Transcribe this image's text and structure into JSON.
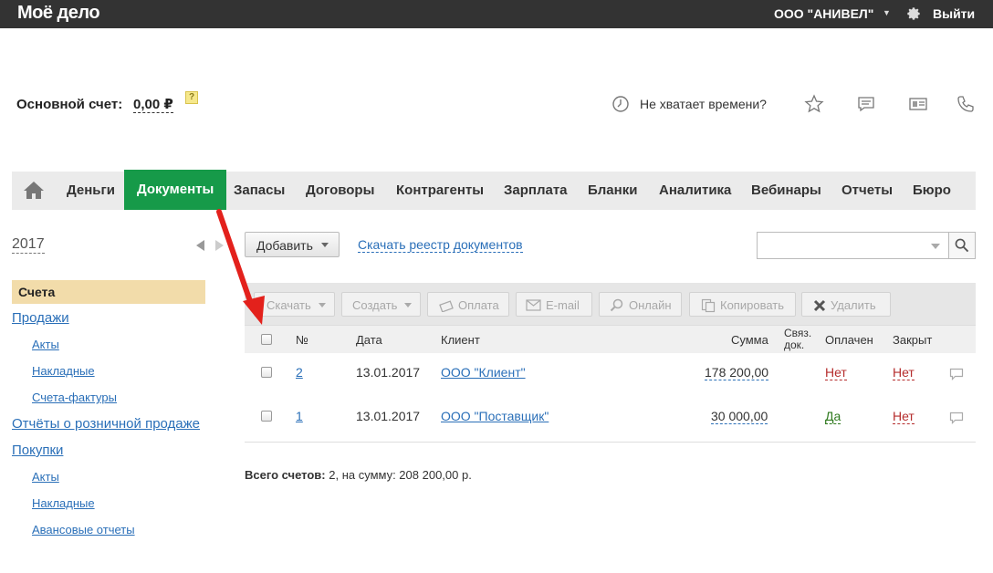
{
  "header": {
    "logo": "Моё дело",
    "company": "ООО \"АНИВЕЛ\"",
    "logout": "Выйти"
  },
  "account": {
    "label": "Основной счет:",
    "value": "0,00 ₽",
    "help": "?"
  },
  "header_actions": {
    "time_text": "Не хватает времени?"
  },
  "nav": {
    "items": [
      {
        "label": "Деньги"
      },
      {
        "label": "Документы",
        "active": true
      },
      {
        "label": "Запасы"
      },
      {
        "label": "Договоры"
      },
      {
        "label": "Контрагенты"
      },
      {
        "label": "Зарплата"
      },
      {
        "label": "Бланки"
      },
      {
        "label": "Аналитика"
      },
      {
        "label": "Вебинары"
      },
      {
        "label": "Отчеты"
      },
      {
        "label": "Бюро"
      }
    ]
  },
  "sidebar": {
    "year": "2017",
    "active": "Счета",
    "items": [
      {
        "label": "Продажи"
      },
      {
        "label": "Акты"
      },
      {
        "label": "Накладные"
      },
      {
        "label": "Счета-фактуры"
      },
      {
        "label": "Отчёты о розничной продаже"
      },
      {
        "label": "Покупки"
      },
      {
        "label": "Акты"
      },
      {
        "label": "Накладные"
      },
      {
        "label": "Авансовые отчеты"
      }
    ]
  },
  "toolbar": {
    "add_label": "Добавить",
    "registry_link": "Скачать реестр документов",
    "search_placeholder": ""
  },
  "actions": {
    "download": "Скачать",
    "create": "Создать",
    "payment": "Оплата",
    "email": "E-mail",
    "online": "Онлайн",
    "copy": "Копировать",
    "delete": "Удалить"
  },
  "table": {
    "headers": {
      "number": "№",
      "date": "Дата",
      "client": "Клиент",
      "sum": "Сумма",
      "linked_1": "Связ.",
      "linked_2": "док.",
      "paid": "Оплачен",
      "closed": "Закрыт"
    },
    "rows": [
      {
        "number": "2",
        "date": "13.01.2017",
        "client": "ООО \"Клиент\"",
        "sum": "178 200,00",
        "paid": "Нет",
        "closed": "Нет"
      },
      {
        "number": "1",
        "date": "13.01.2017",
        "client": "ООО \"Поставщик\"",
        "sum": "30 000,00",
        "paid": "Да",
        "closed": "Нет"
      }
    ]
  },
  "summary": {
    "label": "Всего счетов:",
    "text": "2, на сумму: 208 200,00 р."
  },
  "colors": {
    "topbar": "#333333",
    "nav_active": "#169a49",
    "link": "#2a6fb8",
    "sidebar_active": "#f2dcaa",
    "no": "#b52d2d",
    "yes": "#2f7a1e",
    "annotation_arrow": "#e3211c"
  }
}
